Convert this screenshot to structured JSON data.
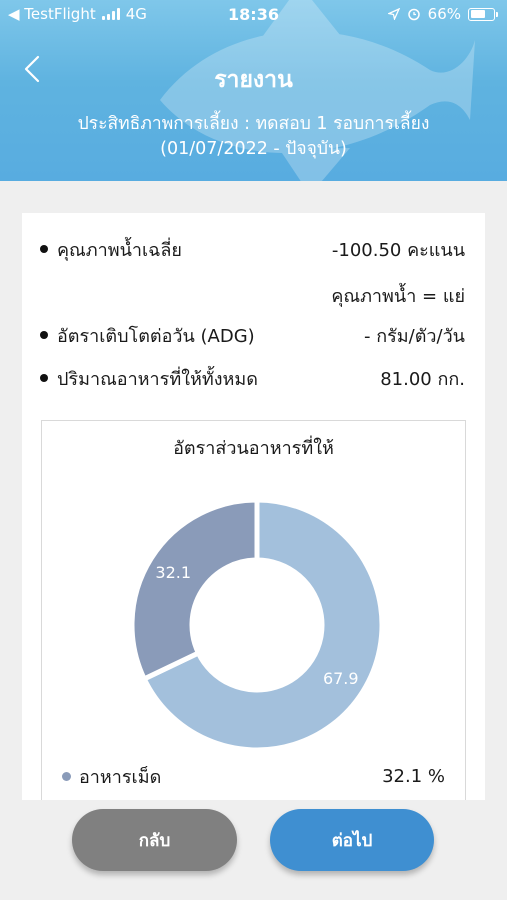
{
  "status_bar": {
    "carrier": "◀ TestFlight",
    "network": "4G",
    "time": "18:36",
    "battery": "66%",
    "battery_level": 0.66
  },
  "header": {
    "title": "รายงาน",
    "subtitle_line1": "ประสิทธิภาพการเลี้ยง : ทดสอบ 1 รอบการเลี้ยง",
    "subtitle_line2": "(01/07/2022 - ปัจจุบัน)"
  },
  "summary": {
    "water_quality_label": "คุณภาพน้ำเฉลี่ย",
    "water_quality_value": "-100.50 คะแนน",
    "water_quality_grade": "คุณภาพน้ำ = แย่",
    "adg_label": "อัตราเติบโตต่อวัน (ADG)",
    "adg_value": "- กรัม/ตัว/วัน",
    "feed_total_label": "ปริมาณอาหารที่ให้ทั้งหมด",
    "feed_total_value": "81.00 กก."
  },
  "chart_data": {
    "type": "pie",
    "title": "อัตราส่วนอาหารที่ให้",
    "slices": [
      {
        "label": "67.9",
        "value": 67.9,
        "color": "#a3c0dc"
      },
      {
        "label": "32.1",
        "value": 32.1,
        "color": "#8a9bb9"
      }
    ],
    "legend": [
      {
        "name": "อาหารเม็ด",
        "value": "32.1 %",
        "color": "#8a9bb9"
      }
    ]
  },
  "buttons": {
    "back_label": "กลับ",
    "next_label": "ต่อไป"
  },
  "colors": {
    "header": "#5fb3e0",
    "next_button": "#3f8fd1",
    "back_button": "#808080"
  }
}
